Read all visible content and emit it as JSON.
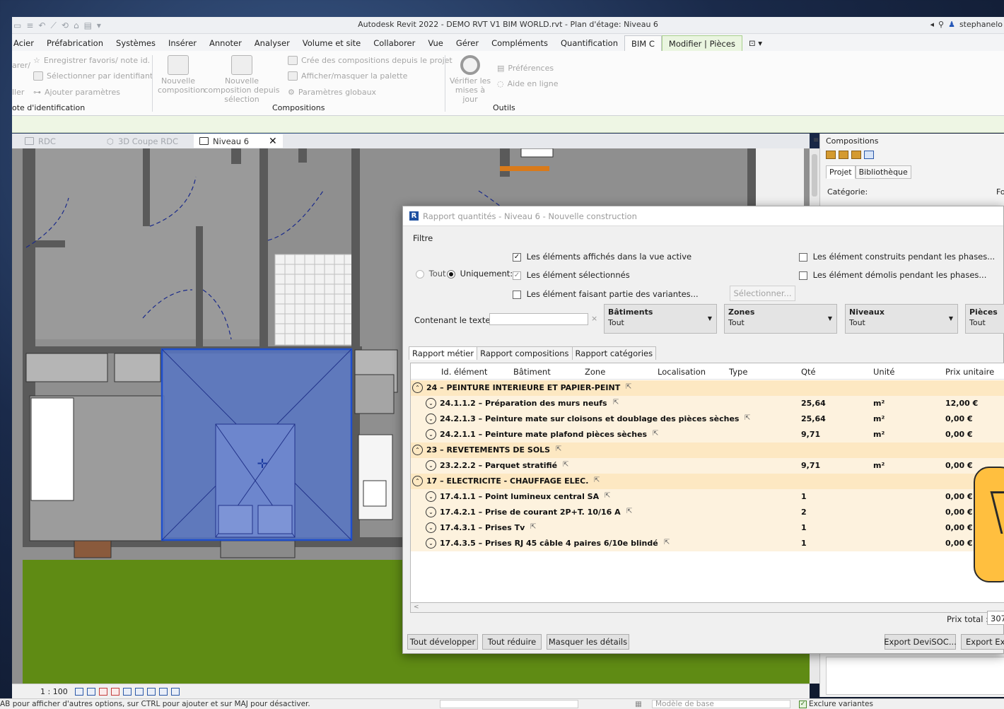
{
  "titlebar": {
    "title": "Autodesk Revit 2022 - DEMO RVT V1 BIM WORLD.rvt - Plan d'étage: Niveau 6",
    "user": "stephanelo"
  },
  "ribbon_tabs": [
    {
      "label": "Acier"
    },
    {
      "label": "Préfabrication"
    },
    {
      "label": "Systèmes"
    },
    {
      "label": "Insérer"
    },
    {
      "label": "Annoter"
    },
    {
      "label": "Analyser"
    },
    {
      "label": "Volume et site"
    },
    {
      "label": "Collaborer"
    },
    {
      "label": "Vue"
    },
    {
      "label": "Gérer"
    },
    {
      "label": "Compléments"
    },
    {
      "label": "Quantification"
    },
    {
      "label": "BIM C"
    },
    {
      "label": "Modifier | Pièces"
    }
  ],
  "ribbon": {
    "id_group": {
      "fav": "Enregistrer favoris/ note id.",
      "select_by_id": "Sélectionner par identifiant",
      "add_params": "Ajouter paramètres",
      "left_frag1": "arer/",
      "left_frag2": "ller",
      "label": "ote d'identification"
    },
    "compositions": {
      "new": "Nouvelle composition",
      "new_from_sel": "Nouvelle composition depuis sélection",
      "create_from_project": "Crée des compositions depuis le projet",
      "toggle_palette": "Afficher/masquer la palette",
      "global_params": "Paramètres globaux",
      "label": "Compositions"
    },
    "tools": {
      "check_updates": "Vérifier les mises à jour",
      "preferences": "Préférences",
      "online_help": "Aide en ligne",
      "label": "Outils"
    }
  },
  "view_tabs": [
    {
      "label": "RDC"
    },
    {
      "label": "3D Coupe RDC"
    },
    {
      "label": "Niveau 6"
    }
  ],
  "palette": {
    "title": "Compositions",
    "tab_project": "Projet",
    "tab_library": "Bibliothèque",
    "category_label": "Catégorie:",
    "extra_label": "Fo"
  },
  "dialog": {
    "title": "Rapport quantités - Niveau 6 - Nouvelle construction",
    "filter_label": "Filtre",
    "opt_visible": "Les éléments affichés dans la vue active",
    "opt_selected": "Les élément sélectionnés",
    "opt_variants": "Les élément faisant partie des variantes...",
    "opt_built": "Les élément construits pendant les phases...",
    "opt_demolished": "Les élément démolis pendant les phases...",
    "radio_all": "Tout",
    "radio_only": "Uniquement:",
    "select_btn": "Sélectionner...",
    "contains_label": "Contenant le texte :",
    "contains_value": "",
    "combos": [
      {
        "name": "Bâtiments",
        "value": "Tout"
      },
      {
        "name": "Zones",
        "value": "Tout"
      },
      {
        "name": "Niveaux",
        "value": "Tout"
      },
      {
        "name": "Pièces",
        "value": "Tout"
      }
    ],
    "report_tabs": [
      {
        "label": "Rapport métier"
      },
      {
        "label": "Rapport compositions"
      },
      {
        "label": "Rapport catégories"
      }
    ],
    "columns": [
      "Id. élément",
      "Bâtiment",
      "Zone",
      "Localisation",
      "Type",
      "Qté",
      "Unité",
      "Prix unitaire"
    ],
    "rows": [
      {
        "kind": "cat",
        "label": "24 – PEINTURE INTERIEURE ET PAPIER-PEINT",
        "qty": "",
        "unit": "",
        "price": ""
      },
      {
        "kind": "item",
        "label": "24.1.1.2 – Préparation des murs neufs",
        "qty": "25,64",
        "unit": "m²",
        "price": "12,00 €"
      },
      {
        "kind": "item",
        "label": "24.2.1.3 – Peinture mate sur cloisons et doublage des pièces sèches",
        "qty": "25,64",
        "unit": "m²",
        "price": "0,00 €"
      },
      {
        "kind": "item",
        "label": "24.2.1.1 – Peinture mate plafond pièces sèches",
        "qty": "9,71",
        "unit": "m²",
        "price": "0,00 €"
      },
      {
        "kind": "cat",
        "label": "23 – REVETEMENTS DE SOLS",
        "qty": "",
        "unit": "",
        "price": ""
      },
      {
        "kind": "item",
        "label": "23.2.2.2 – Parquet stratifié",
        "qty": "9,71",
        "unit": "m²",
        "price": "0,00 €"
      },
      {
        "kind": "cat",
        "label": "17 – ELECTRICITE - CHAUFFAGE ELEC.",
        "qty": "",
        "unit": "",
        "price": ""
      },
      {
        "kind": "item",
        "label": "17.4.1.1 – Point lumineux central SA",
        "qty": "1",
        "unit": "",
        "price": "0,00 €"
      },
      {
        "kind": "item",
        "label": "17.4.2.1 – Prise de courant 2P+T. 10/16  A",
        "qty": "2",
        "unit": "",
        "price": "0,00 €"
      },
      {
        "kind": "item",
        "label": "17.4.3.1 – Prises Tv",
        "qty": "1",
        "unit": "",
        "price": "0,00 €"
      },
      {
        "kind": "item",
        "label": "17.4.3.5 – Prises RJ 45 câble 4 paires 6/10e blindé",
        "qty": "1",
        "unit": "",
        "price": "0,00 €"
      }
    ],
    "total_label": "Prix total :",
    "total_value": "307",
    "btn_expand_all": "Tout développer",
    "btn_collapse_all": "Tout réduire",
    "btn_hide_details": "Masquer les détails",
    "btn_export_devisoc": "Export DeviSOC...",
    "btn_export_excel": "Export Ex"
  },
  "viewbar": {
    "scale": "1 : 100"
  },
  "statusbar": {
    "message": "AB pour afficher d'autres options, sur CTRL pour ajouter et sur MAJ pour désactiver.",
    "model_value": "Modèle de base",
    "exclude_variants": "Exclure variantes"
  },
  "colors": {
    "category_row": "#fde8c2",
    "item_row": "#fdf2de",
    "selection_blue": "#3f64c4",
    "floor_green": "#5f8b14",
    "cursor_yellow": "#ffbf3f"
  }
}
